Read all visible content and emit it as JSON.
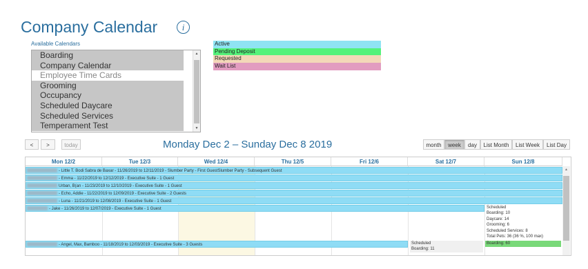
{
  "header": {
    "title": "Company Calendar",
    "info_glyph": "i"
  },
  "calendars": {
    "label": "Available Calendars",
    "items": [
      {
        "label": "Boarding",
        "selected": true
      },
      {
        "label": "Company Calendar",
        "selected": true
      },
      {
        "label": "Employee Time Cards",
        "selected": false
      },
      {
        "label": "Grooming",
        "selected": true
      },
      {
        "label": "Occupancy",
        "selected": true
      },
      {
        "label": "Scheduled Daycare",
        "selected": true
      },
      {
        "label": "Scheduled Services",
        "selected": true
      },
      {
        "label": "Temperament Test",
        "selected": true
      }
    ]
  },
  "legend": [
    {
      "label": "Active",
      "color": "#8fe3f3"
    },
    {
      "label": "Pending Deposit",
      "color": "#54f27a"
    },
    {
      "label": "Requested",
      "color": "#f3d8b8"
    },
    {
      "label": "Wait List",
      "color": "#e29cc0"
    }
  ],
  "toolbar": {
    "prev": "<",
    "next": ">",
    "today": "today",
    "range_title": "Monday Dec 2 – Sunday Dec 8 2019",
    "views": [
      "month",
      "week",
      "day",
      "List Month",
      "List Week",
      "List Day"
    ],
    "active_view": "week"
  },
  "days": [
    "Mon 12/2",
    "Tue 12/3",
    "Wed 12/4",
    "Thu 12/5",
    "Fri 12/6",
    "Sat 12/7",
    "Sun 12/8"
  ],
  "events": [
    {
      "text": "- Little T. Bodi Sabra de Baxar - 11/26/2019 to 12/11/2019 - Slumber Party - First GuestSlumber Party - Subsequent Guest"
    },
    {
      "text": "- Emma - 11/22/2019 to 12/12/2019 - Executive Suite - 1 Guest"
    },
    {
      "text": "Urban, B(an - 11/23/2019 to 12/10/2019 - Executive Suite - 1 Guest"
    },
    {
      "text": "- Echo, Addie - 11/22/2019 to 12/09/2019 - Executive Suite - 2 Guests"
    },
    {
      "text": "- Luna - 11/21/2019 to 12/08/2019 - Executive Suite - 1 Guest"
    },
    {
      "text": "- Jake - 11/26/2019 to 12/07/2019 - Executive Suite - 1 Guest"
    },
    {
      "text": "- Angel, Max, Bamboo - 11/18/2019 to 12/03/2019 - Executive Suite - 3 Guests"
    }
  ],
  "summary_sun": [
    "Scheduled",
    "Boarding: 10",
    "Daycare: 14",
    "Grooming: 6",
    "Scheduled Services: 8",
    "Total Pets: 36 (36 %, 100 max)"
  ],
  "summary_sun_green": "Boarding: 60",
  "summary_sat": [
    "Scheduled",
    "Boarding: 11"
  ]
}
